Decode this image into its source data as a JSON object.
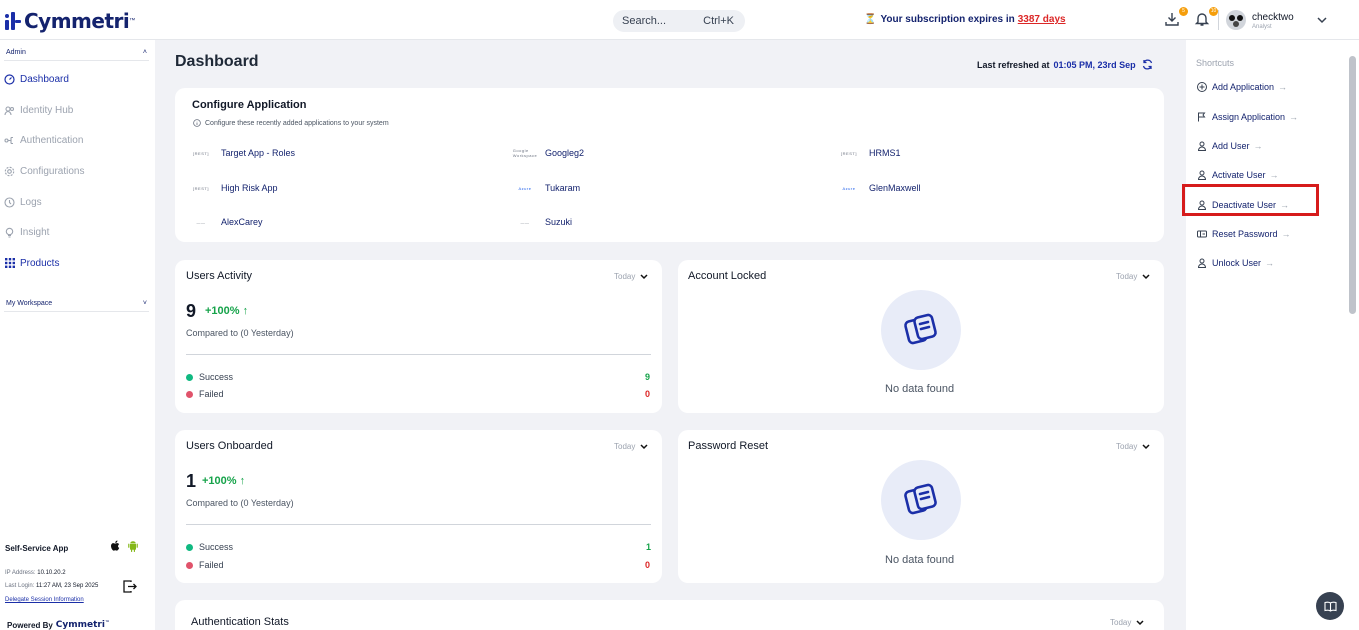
{
  "topbar": {
    "logo_text": "Cymmetri",
    "logo_tm": "™",
    "search_placeholder": "Search...",
    "search_shortcut": "Ctrl+K",
    "subscription_text": "Your subscription expires in",
    "subscription_days": "3387 days",
    "download_badge": "5",
    "notification_badge": "10",
    "user_name": "checktwo",
    "user_role": "Analyst"
  },
  "sidebar": {
    "section_admin": "Admin",
    "items": [
      {
        "label": "Dashboard",
        "icon": "dashboard-icon"
      },
      {
        "label": "Identity Hub",
        "icon": "identity-icon"
      },
      {
        "label": "Authentication",
        "icon": "authentication-icon"
      },
      {
        "label": "Configurations",
        "icon": "gear-icon"
      },
      {
        "label": "Logs",
        "icon": "logs-icon"
      },
      {
        "label": "Insight",
        "icon": "insight-icon"
      },
      {
        "label": "Products",
        "icon": "grid-icon"
      }
    ],
    "section_workspace": "My Workspace",
    "self_service": "Self-Service App",
    "ip_label": "IP Address:",
    "ip_value": "10.10.20.2",
    "last_login_label": "Last Login:",
    "last_login_value": "11:27 AM, 23 Sep 2025",
    "delegate": "Delegate Session Information",
    "powered_by": "Powered By",
    "powered_logo": "Cymmetri",
    "powered_tm": "™"
  },
  "main": {
    "title": "Dashboard",
    "last_refreshed_label": "Last refreshed at",
    "last_refreshed_value": "01:05 PM, 23rd Sep",
    "configure": {
      "title": "Configure Application",
      "subtitle": "Configure these recently added applications to your system",
      "apps": [
        {
          "name": "Target App - Roles",
          "logo": "[REST]"
        },
        {
          "name": "Googleg2",
          "logo": "Google Workspace"
        },
        {
          "name": "HRMS1",
          "logo": "[REST]"
        },
        {
          "name": "High Risk App",
          "logo": "[REST]"
        },
        {
          "name": "Tukaram",
          "logo": "Azure"
        },
        {
          "name": "GlenMaxwell",
          "logo": "Azure"
        },
        {
          "name": "AlexCarey",
          "logo": "——"
        },
        {
          "name": "Suzuki",
          "logo": "——"
        }
      ]
    },
    "users_activity": {
      "title": "Users Activity",
      "filter": "Today",
      "count": "9",
      "percent": "+100%",
      "compared": "Compared to (0 Yesterday)",
      "success_label": "Success",
      "success_value": "9",
      "failed_label": "Failed",
      "failed_value": "0"
    },
    "account_locked": {
      "title": "Account Locked",
      "filter": "Today",
      "empty": "No data found"
    },
    "users_onboarded": {
      "title": "Users Onboarded",
      "filter": "Today",
      "count": "1",
      "percent": "+100%",
      "compared": "Compared to (0 Yesterday)",
      "success_label": "Success",
      "success_value": "1",
      "failed_label": "Failed",
      "failed_value": "0"
    },
    "password_reset": {
      "title": "Password Reset",
      "filter": "Today",
      "empty": "No data found"
    },
    "auth_stats": {
      "title": "Authentication Stats",
      "filter": "Today"
    }
  },
  "shortcuts": {
    "title": "Shortcuts",
    "items": [
      {
        "label": "Add Application",
        "icon": "plus-square-icon"
      },
      {
        "label": "Assign Application",
        "icon": "flag-icon"
      },
      {
        "label": "Add User",
        "icon": "user-icon"
      },
      {
        "label": "Activate User",
        "icon": "user-icon"
      },
      {
        "label": "Deactivate User",
        "icon": "user-icon"
      },
      {
        "label": "Reset Password",
        "icon": "key-icon"
      },
      {
        "label": "Unlock User",
        "icon": "user-icon"
      }
    ],
    "arrow": "→"
  },
  "colors": {
    "brand": "#14236e",
    "accent": "#1b2fa8",
    "success": "#16a34a",
    "failed": "#dc2626",
    "highlight": "#d61b1b"
  }
}
